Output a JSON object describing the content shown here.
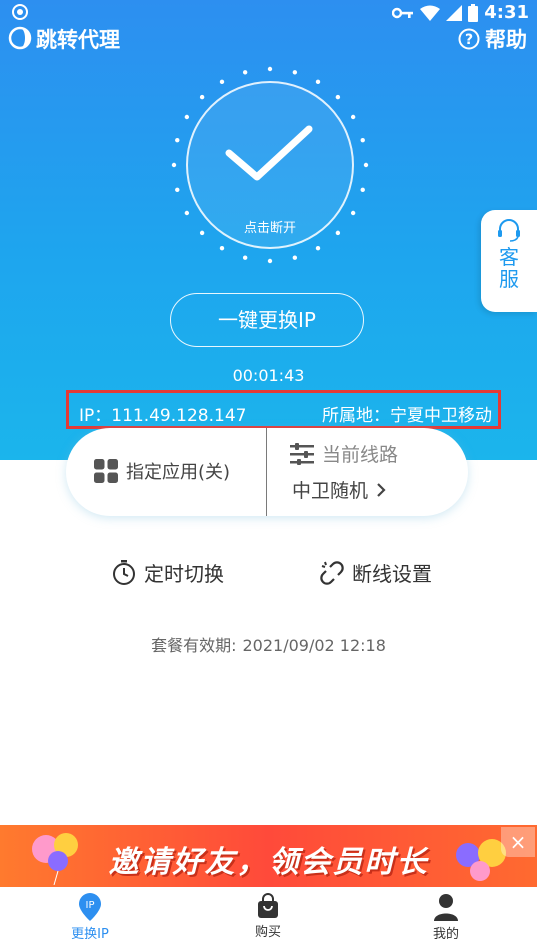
{
  "status_bar": {
    "time": "4:31"
  },
  "header": {
    "title": "跳转代理",
    "help_label": "帮助"
  },
  "connection": {
    "disconnect_hint": "点击断开",
    "switch_button": "一键更换IP",
    "elapsed": "00:01:43",
    "ip_label": "IP：",
    "ip_value": "111.49.128.147",
    "location_label": "所属地：",
    "location_value": "宁夏中卫移动"
  },
  "customer_service": {
    "label": "客服"
  },
  "card": {
    "app_select_label": "指定应用(关)",
    "route_title": "当前线路",
    "route_value": "中卫随机"
  },
  "actions": {
    "timed_switch": "定时切换",
    "disconnect_settings": "断线设置"
  },
  "expiry": {
    "label": "套餐有效期:",
    "value": "2021/09/02 12:18"
  },
  "banner": {
    "text": "邀请好友，领会员时长",
    "close": "×"
  },
  "bottom_nav": [
    {
      "label": "更换IP",
      "icon": "ip-icon",
      "active": true
    },
    {
      "label": "购买",
      "icon": "shopping-bag-icon",
      "active": false
    },
    {
      "label": "我的",
      "icon": "user-icon",
      "active": false
    }
  ],
  "colors": {
    "primary": "#2d8ff0",
    "highlight_border": "#e53935",
    "banner": "#ff5a35"
  }
}
